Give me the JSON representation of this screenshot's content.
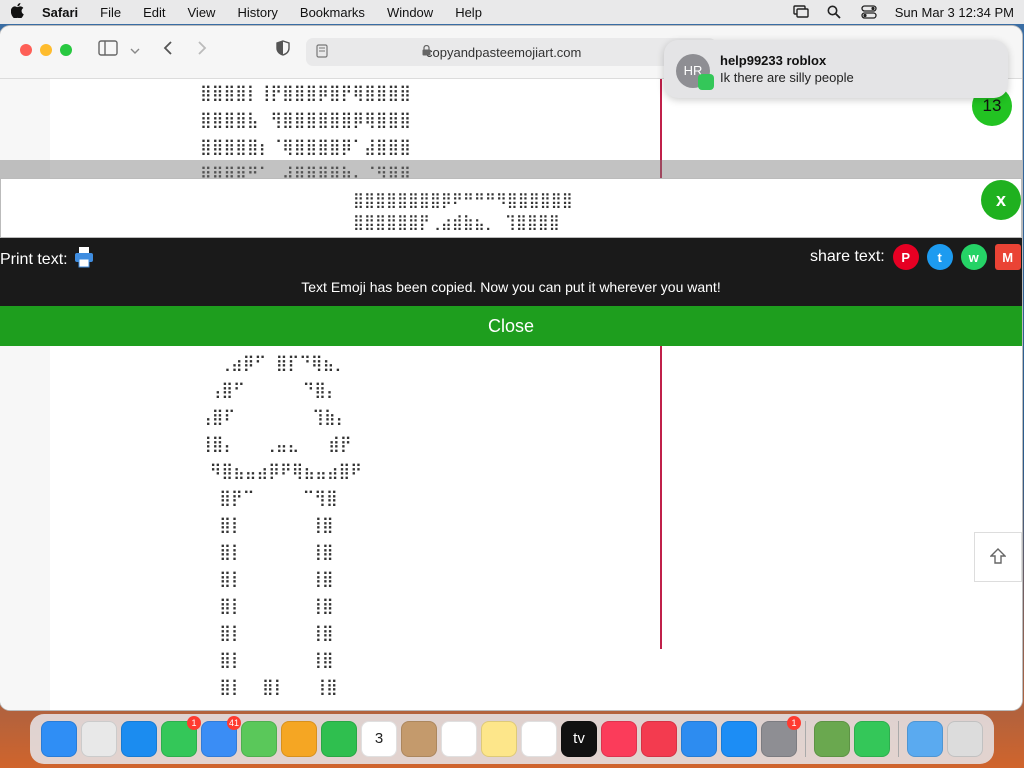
{
  "menubar": {
    "app": "Safari",
    "items": [
      "File",
      "Edit",
      "View",
      "History",
      "Bookmarks",
      "Window",
      "Help"
    ],
    "clock": "Sun Mar 3  12:34 PM"
  },
  "browser": {
    "url": "copyandpasteemojiart.com"
  },
  "art": {
    "rows": [
      "⣿⣿⣿⣿⡇⢸⡟⣿⣿⣿⡿⣿⡟⢿⣿⣿⣿⣿",
      "⣿⣿⣿⣿⣧⠀⢻⣿⣿⣿⣿⣿⣿⡿⢿⣿⣿⣿",
      "⣿⣿⣿⣿⣿⡆⠈⢿⣿⣿⣿⣿⡿⠁⣼⣿⣿⣿",
      "⣿⣿⡿⠿⠛⠁⢀⣼⣿⣿⣿⣿⣷⣄⠈⢻⣿⣿",
      "",
      "",
      "",
      "",
      "",
      "   ⣀⣀⣀⣀⣀⣀⣀",
      "  ⢀⣴⡿⠋ ⣿⡏⠙⢿⣦⡀",
      " ⢠⣿⠋      ⠙⣿⡄",
      "⢠⣿⠏        ⢹⣷⡄",
      "⢸⣿⡄   ⢀⣤⣄   ⣾⡟",
      " ⠻⣿⣦⣤⣴⡿⠟⢿⣦⣤⣴⣿⠟",
      "  ⣿⡟⠉     ⠉⢻⣿",
      "  ⣿⡇       ⢸⣿",
      "  ⣿⡇       ⢸⣿",
      "  ⣿⡇       ⢸⣿",
      "  ⣿⡇       ⢸⣿",
      "  ⣿⡇       ⢸⣿",
      "  ⣿⡇       ⢸⣿",
      "  ⣿⡇  ⣿⡇   ⢸⣿"
    ]
  },
  "modal": {
    "preview_rows": [
      "⣿⣿⣿⣿⣿⣿⣿⣿⡿⠟⠛⠛⠛⠻⣿⣿⣿⣿⣿⣿",
      "⣿⣿⣿⣿⣿⣿⡟⢀⣴⣾⣷⣦⡀ ⢹⣿⣿⣿⣿"
    ],
    "close_x": "x",
    "print_label": "Print text:",
    "share_label": "share text:",
    "copied_message": "Text Emoji has been copied. Now you can put it wherever you want!",
    "close_button": "Close"
  },
  "social": [
    {
      "name": "pinterest",
      "glyph": "P",
      "color": "#e60023"
    },
    {
      "name": "twitter",
      "glyph": "t",
      "color": "#1d9bf0"
    },
    {
      "name": "whatsapp",
      "glyph": "w",
      "color": "#25d366"
    },
    {
      "name": "gmail",
      "glyph": "M",
      "color": "#ea4335"
    }
  ],
  "notification": {
    "initials": "HR",
    "title": "help99233 roblox",
    "body": "Ik there are silly people"
  },
  "counter": "13",
  "dock": {
    "apps": [
      {
        "name": "finder",
        "color": "#2f8ef5"
      },
      {
        "name": "launchpad",
        "color": "#e8e8e8"
      },
      {
        "name": "safari",
        "color": "#1b8cf0"
      },
      {
        "name": "messages",
        "color": "#34c759",
        "badge": "1"
      },
      {
        "name": "mail",
        "color": "#3a8df5",
        "badge": "41"
      },
      {
        "name": "maps",
        "color": "#5ac85a"
      },
      {
        "name": "photos",
        "color": "#f5a623"
      },
      {
        "name": "facetime",
        "color": "#2fbf4f"
      },
      {
        "name": "calendar",
        "color": "#ffffff",
        "text": "3"
      },
      {
        "name": "contacts",
        "color": "#c49a6c"
      },
      {
        "name": "reminders",
        "color": "#ffffff"
      },
      {
        "name": "notes",
        "color": "#fde68a"
      },
      {
        "name": "freeform",
        "color": "#ffffff"
      },
      {
        "name": "appletv",
        "color": "#111111",
        "text": "tv"
      },
      {
        "name": "music",
        "color": "#fb3c5a"
      },
      {
        "name": "news",
        "color": "#f33b4f"
      },
      {
        "name": "keynote",
        "color": "#2d8cf0"
      },
      {
        "name": "appstore",
        "color": "#1c8df5"
      },
      {
        "name": "system-settings",
        "color": "#8e8e93",
        "badge": "1"
      },
      {
        "name": "minecraft",
        "color": "#6aa84f"
      },
      {
        "name": "findmy",
        "color": "#34c759"
      },
      {
        "name": "downloads-folder",
        "color": "#5aaaf0"
      },
      {
        "name": "trash",
        "color": "#dcdcdc"
      }
    ]
  }
}
